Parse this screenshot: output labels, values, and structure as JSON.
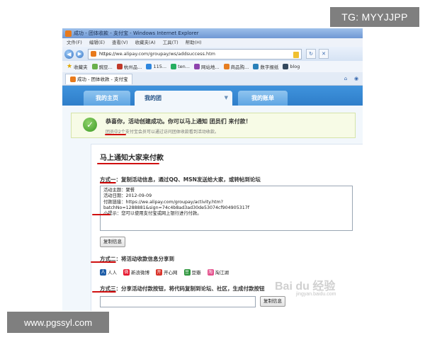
{
  "watermarks": {
    "top_right": "TG: MYYJJPP",
    "bottom_left": "www.pgssyl.com",
    "baidu": "Bai du 经验",
    "baidu_url": "jingyan.baidu.com"
  },
  "window": {
    "title": "成功 - 团体收款 - 支付宝 - Windows Internet Explorer"
  },
  "menu": [
    "文件(F)",
    "编辑(E)",
    "查看(V)",
    "收藏夹(A)",
    "工具(T)",
    "帮助(H)"
  ],
  "address": {
    "https": "https://",
    "url": "we.alipay.com/groupay/ws/addsuccess.htm"
  },
  "favorites": {
    "label": "收藏夹",
    "items": [
      "豌豆...",
      "杭州品...",
      "115...",
      "ten...",
      "网站地...",
      "商品购...",
      "数字报纸",
      "blog"
    ]
  },
  "ie_tab": {
    "label": "成功 - 团体收款 - 支付宝"
  },
  "site_tabs": {
    "home": "我的主页",
    "groups": "我的团",
    "account": "我的账单"
  },
  "success": {
    "title": "恭喜你，活动创建成功。你可以马上通知 团员们 来付款！",
    "subtitle": "团员中2个支付宝会员可以通过访问团体收款看到活动收款。"
  },
  "panel": {
    "title": "马上通知大家来付款",
    "method1": {
      "label": "方式一",
      "text": "：复制活动信息，通过QQ、MSN发送给大家，或转帖到论坛"
    },
    "info_lines": [
      "活动主题：聚餐",
      "活动日期：2012-09-09",
      "付款链接：https://we.alipay.com/groupay/activity.htm?",
      "batchNo=1288881&sign=74c4b8ad3ad30de53074cf904905317f",
      "小提示：您可以使用支付宝或网上银行进行付款。"
    ],
    "copy_label": "复制信息",
    "method2": {
      "label": "方式二",
      "text": "：将活动收款信息分享到"
    },
    "shares": [
      "人人",
      "新浪微博",
      "开心网",
      "豆瓣",
      "淘江湖"
    ],
    "method3": {
      "label": "方式三",
      "text": "：分享活动付款按钮，将代码复制到论坛、社区，生成付款按钮"
    }
  }
}
